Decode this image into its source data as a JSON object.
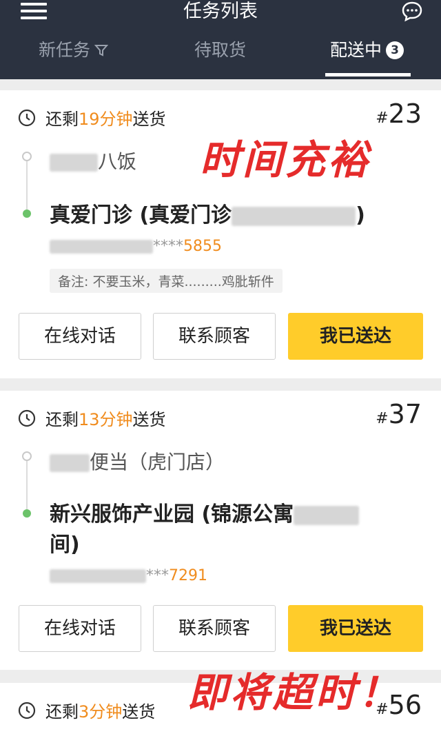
{
  "header": {
    "title": "任务列表",
    "tabs": [
      {
        "label": "新任务"
      },
      {
        "label": "待取货"
      },
      {
        "label": "配送中",
        "count": "3"
      }
    ]
  },
  "orders": [
    {
      "timer_prefix": "还剩",
      "timer_value": "19分钟",
      "timer_suffix": "送货",
      "hash": "#",
      "number": "23",
      "store": "八饭",
      "address": "真爱门诊 (真爱门诊",
      "address_close": ")",
      "phone_mask": "****",
      "phone_tail": "5855",
      "note": "备注: 不要玉米，青菜.........鸡肶斩件",
      "actions": [
        "在线对话",
        "联系顾客",
        "我已送达"
      ]
    },
    {
      "timer_prefix": "还剩",
      "timer_value": "13分钟",
      "timer_suffix": "送货",
      "hash": "#",
      "number": "37",
      "store": "便当（虎门店）",
      "address": "新兴服饰产业园 (锦源公寓",
      "address_line2": "间)",
      "phone_mask": "***",
      "phone_tail": "7291",
      "actions": [
        "在线对话",
        "联系顾客",
        "我已送达"
      ]
    },
    {
      "timer_prefix": "还剩",
      "timer_value": "3分钟",
      "timer_suffix": "送货",
      "hash": "#",
      "number": "56"
    }
  ],
  "annotations": {
    "stamp_1": "时间充裕",
    "stamp_2": "即将超时！"
  },
  "colors": {
    "header_bg": "#2b3240",
    "accent_orange": "#f08c1e",
    "primary_button": "#ffcc2a",
    "stamp_red": "#e52b2b",
    "status_green": "#6cc36a"
  }
}
